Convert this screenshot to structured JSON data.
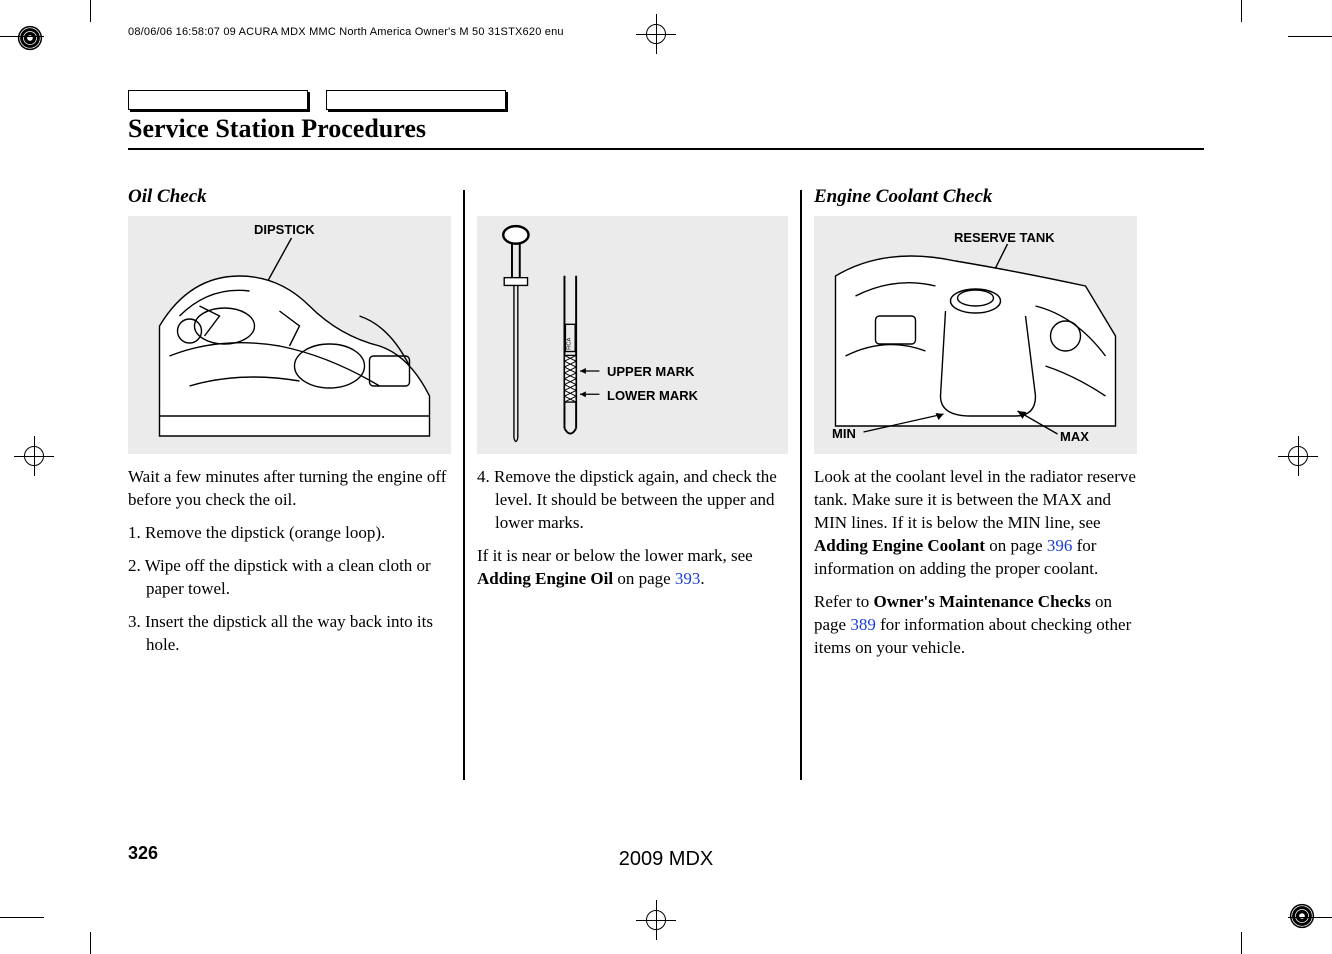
{
  "header": {
    "slug": "08/06/06 16:58:07    09 ACURA MDX MMC North America Owner's M 50 31STX620 enu"
  },
  "title": "Service Station Procedures",
  "col1": {
    "heading": "Oil Check",
    "figure": {
      "label_dipstick": "DIPSTICK"
    },
    "intro": "Wait a few minutes after turning the engine off before you check the oil.",
    "step1": "1. Remove the dipstick (orange loop).",
    "step2": "2. Wipe off the dipstick with a clean cloth or paper towel.",
    "step3": "3. Insert the dipstick all the way back into its hole."
  },
  "col2": {
    "figure": {
      "label_upper": "UPPER MARK",
      "label_lower": "LOWER MARK"
    },
    "step4": "4. Remove the dipstick again, and check the level. It should be between the upper and lower marks.",
    "p2_pre": "If it is near or below the lower mark, see ",
    "p2_bold": "Adding Engine Oil",
    "p2_mid": " on page ",
    "p2_link": "393",
    "p2_post": "."
  },
  "col3": {
    "heading": "Engine Coolant Check",
    "figure": {
      "label_reserve": "RESERVE TANK",
      "label_min": "MIN",
      "label_max": "MAX"
    },
    "p1_pre": "Look at the coolant level in the radiator reserve tank. Make sure it is between the MAX and MIN lines. If it is below the MIN line, see ",
    "p1_bold": "Adding Engine Coolant",
    "p1_mid": " on page ",
    "p1_link": "396",
    "p1_post": " for information on adding the proper coolant.",
    "p2_pre": "Refer to ",
    "p2_bold": "Owner's Maintenance Checks",
    "p2_mid": " on page ",
    "p2_link": "389",
    "p2_post": " for information about checking other items on your vehicle."
  },
  "footer": {
    "page": "326",
    "model": "2009  MDX"
  }
}
